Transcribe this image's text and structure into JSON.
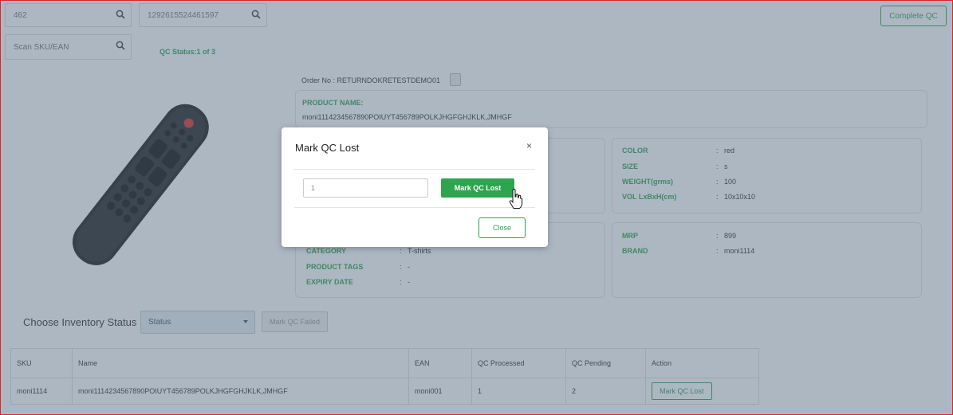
{
  "search": {
    "box1_value": "462",
    "box2_value": "1292615524461597",
    "sku_placeholder": "Scan SKU/EAN"
  },
  "header": {
    "complete_qc_label": "Complete QC",
    "qc_status": "QC Status:1 of 3"
  },
  "order": {
    "order_no": "Order No  : RETURNDOKRETESTDEMO01"
  },
  "product": {
    "name_label": "PRODUCT NAME:",
    "name_value": "moni1114234567890POIUYT456789POLKJHGFGHJKLK,JMHGF",
    "color_label": "COLOR",
    "color_value": "red",
    "size_label": "SIZE",
    "size_value": "s",
    "weight_label": "WEIGHT(grms)",
    "weight_value": "100",
    "vol_label": "VOL LxBxH(cm)",
    "vol_value": "10x10x10",
    "category_label": "CATEGORY",
    "category_value": "T-shirts",
    "tags_label": "PRODUCT TAGS",
    "tags_value": "-",
    "expiry_label": "EXPIRY DATE",
    "expiry_value": "-",
    "mrp_label": "MRP",
    "mrp_value": "899",
    "brand_label": "BRAND",
    "brand_value": "moni1114",
    "colon": ":"
  },
  "inventory": {
    "label": "Choose Inventory Status",
    "select_value": "Status",
    "mark_failed_label": "Mark QC Failed"
  },
  "table": {
    "headers": [
      "SKU",
      "Name",
      "EAN",
      "QC Processed",
      "QC Pending",
      "Action"
    ],
    "rows": [
      {
        "sku": "moni1114",
        "name": "moni1114234567890POIUYT456789POLKJHGFGHJKLK,JMHGF",
        "ean": "moni001",
        "processed": "1",
        "pending": "2",
        "action": "Mark QC Lost"
      }
    ]
  },
  "modal": {
    "title": "Mark QC Lost",
    "close_symbol": "×",
    "qty_value": "1",
    "mark_lost_label": "Mark QC Lost",
    "close_label": "Close"
  },
  "colors": {
    "accent_green": "#2ea44f",
    "overlay": "#54687f",
    "frame_border": "#d9262c"
  },
  "icons": [
    "search-icon",
    "copy-icon",
    "close-icon",
    "hand-cursor-icon",
    "chevron-down-icon"
  ]
}
